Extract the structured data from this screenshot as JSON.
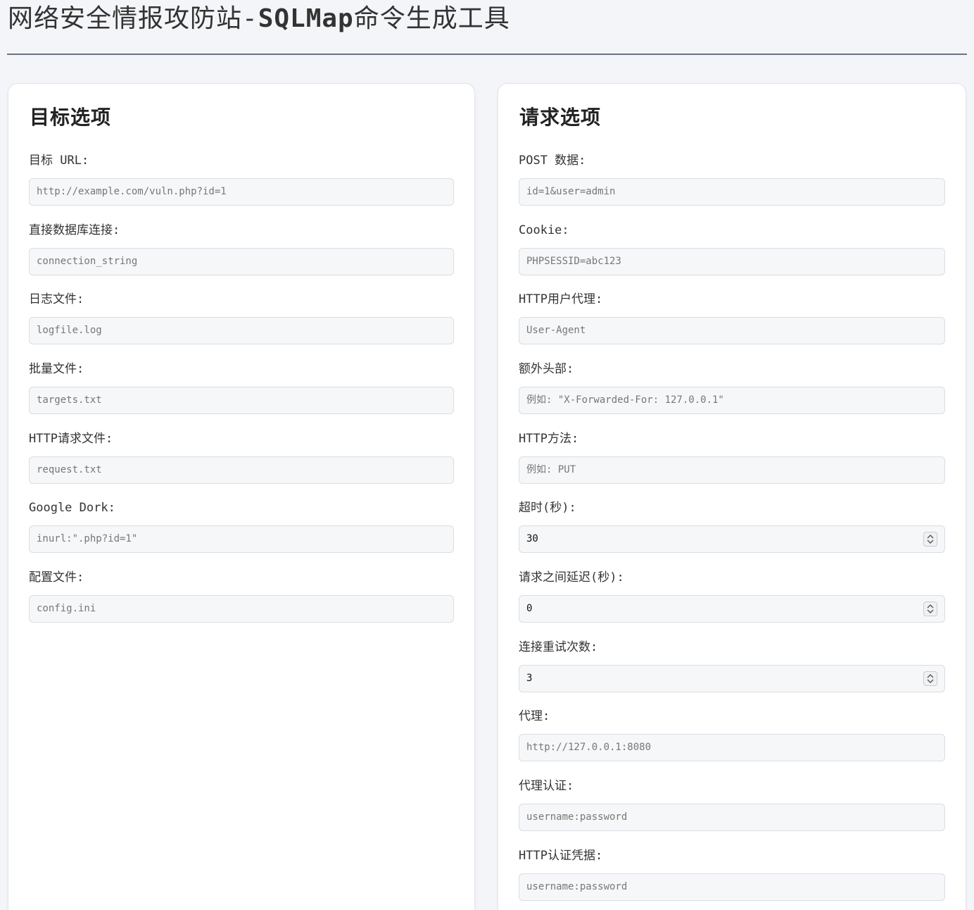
{
  "page": {
    "title_prefix": "网络安全情报攻防站-",
    "title_accent": "SQLMap",
    "title_suffix": "命令生成工具"
  },
  "target_panel": {
    "heading": "目标选项",
    "fields": [
      {
        "label": "目标 URL:",
        "placeholder": "http://example.com/vuln.php?id=1"
      },
      {
        "label": "直接数据库连接:",
        "placeholder": "connection_string"
      },
      {
        "label": "日志文件:",
        "placeholder": "logfile.log"
      },
      {
        "label": "批量文件:",
        "placeholder": "targets.txt"
      },
      {
        "label": "HTTP请求文件:",
        "placeholder": "request.txt"
      },
      {
        "label": "Google Dork:",
        "placeholder": "inurl:\".php?id=1\""
      },
      {
        "label": "配置文件:",
        "placeholder": "config.ini"
      }
    ]
  },
  "request_panel": {
    "heading": "请求选项",
    "fields": [
      {
        "label": "POST 数据:",
        "placeholder": "id=1&user=admin"
      },
      {
        "label": "Cookie:",
        "placeholder": "PHPSESSID=abc123"
      },
      {
        "label": "HTTP用户代理:",
        "placeholder": "User-Agent"
      },
      {
        "label": "额外头部:",
        "placeholder": "例如: \"X-Forwarded-For: 127.0.0.1\""
      },
      {
        "label": "HTTP方法:",
        "placeholder": "例如: PUT"
      },
      {
        "label": "超时(秒):",
        "value": "30"
      },
      {
        "label": "请求之间延迟(秒):",
        "value": "0"
      },
      {
        "label": "连接重试次数:",
        "value": "3"
      },
      {
        "label": "代理:",
        "placeholder": "http://127.0.0.1:8080"
      },
      {
        "label": "代理认证:",
        "placeholder": "username:password"
      },
      {
        "label": "HTTP认证凭据:",
        "placeholder": "username:password"
      }
    ]
  },
  "icons": {
    "number_stepper": "up-down-chevron-icon"
  }
}
